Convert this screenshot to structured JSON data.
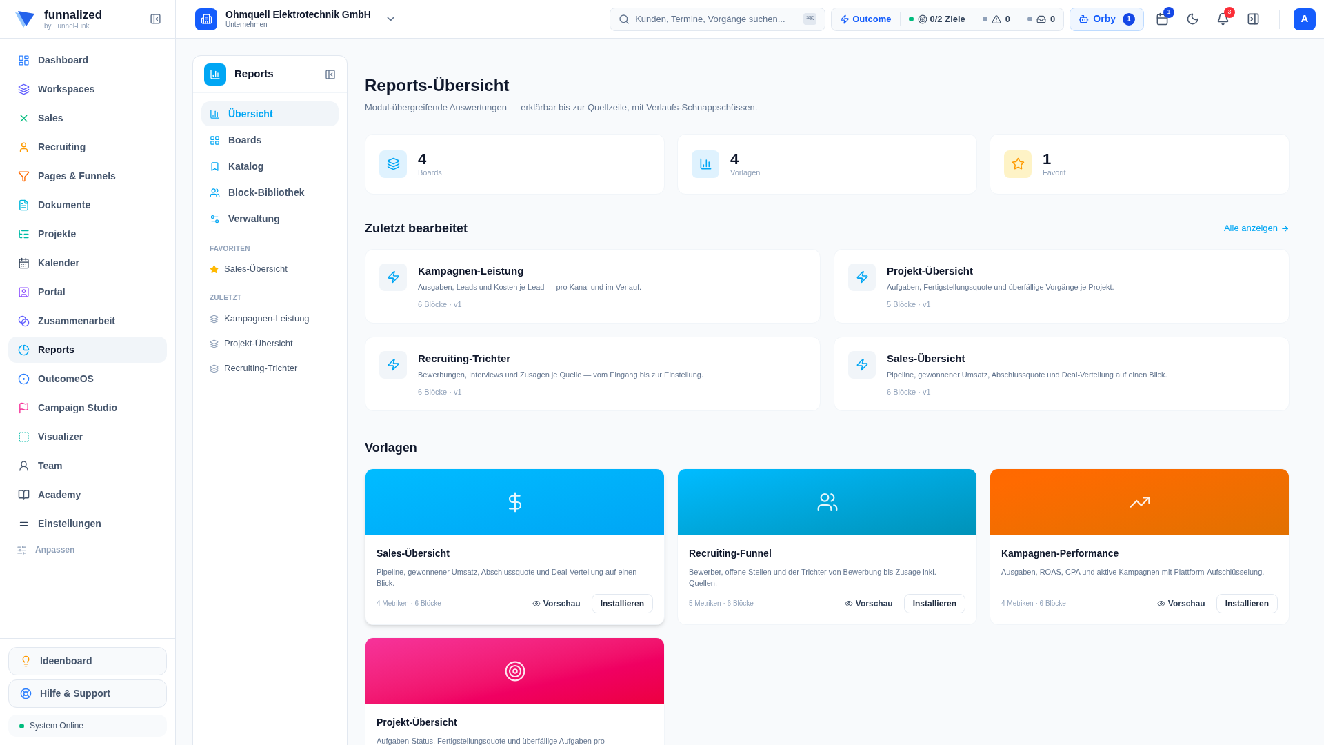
{
  "brand": {
    "name": "funnalized",
    "tagline": "by Funnel-Link"
  },
  "company": {
    "name": "Ohmquell Elektrotechnik GmbH",
    "type": "Unternehmen"
  },
  "search": {
    "placeholder": "Kunden, Termine, Vorgänge suchen...",
    "shortcut": "⌘K"
  },
  "status": {
    "outcome": "Outcome",
    "goals": "0/2 Ziele",
    "warnings": "0",
    "inbox": "0"
  },
  "orby": {
    "label": "Orby",
    "count": "1"
  },
  "calendar_badge": "1",
  "notifications_badge": "3",
  "avatar": "A",
  "nav": {
    "items": [
      {
        "label": "Dashboard",
        "selected": false
      },
      {
        "label": "Workspaces",
        "selected": false
      },
      {
        "label": "Sales",
        "selected": false
      },
      {
        "label": "Recruiting",
        "selected": false
      },
      {
        "label": "Pages & Funnels",
        "selected": false
      },
      {
        "label": "Dokumente",
        "selected": false
      },
      {
        "label": "Projekte",
        "selected": false
      },
      {
        "label": "Kalender",
        "selected": false
      },
      {
        "label": "Portal",
        "selected": false
      },
      {
        "label": "Zusammenarbeit",
        "selected": false
      },
      {
        "label": "Reports",
        "selected": true
      },
      {
        "label": "OutcomeOS",
        "selected": false
      },
      {
        "label": "Campaign Studio",
        "selected": false
      },
      {
        "label": "Visualizer",
        "selected": false
      },
      {
        "label": "Team",
        "selected": false
      },
      {
        "label": "Academy",
        "selected": false
      },
      {
        "label": "Einstellungen",
        "selected": false
      }
    ],
    "customize": "Anpassen"
  },
  "footer": {
    "buttons": [
      "Ideenboard",
      "Hilfe & Support"
    ],
    "status": "System Online"
  },
  "reports_nav": {
    "title": "Reports",
    "items": [
      {
        "label": "Übersicht",
        "selected": true
      },
      {
        "label": "Boards",
        "selected": false
      },
      {
        "label": "Katalog",
        "selected": false
      },
      {
        "label": "Block-Bibliothek",
        "selected": false
      },
      {
        "label": "Verwaltung",
        "selected": false
      }
    ],
    "favorites": {
      "heading": "FAVORITEN",
      "items": [
        "Sales-Übersicht"
      ]
    },
    "recent": {
      "heading": "ZULETZT",
      "items": [
        "Kampagnen-Leistung",
        "Projekt-Übersicht",
        "Recruiting-Trichter"
      ]
    }
  },
  "header": {
    "title": "Reports-Übersicht",
    "subtitle": "Modul-übergreifende Auswertungen — erklärbar bis zur Quellzeile, mit Verlaufs-Schnappschüssen."
  },
  "stats": [
    {
      "value": "4",
      "label": "Boards"
    },
    {
      "value": "4",
      "label": "Vorlagen"
    },
    {
      "value": "1",
      "label": "Favorit"
    }
  ],
  "recent": {
    "title": "Zuletzt bearbeitet",
    "link": "Alle anzeigen",
    "items": [
      {
        "title": "Kampagnen-Leistung",
        "description": "Ausgaben, Leads und Kosten je Lead — pro Kanal und im Verlauf.",
        "meta": "6 Blöcke · v1"
      },
      {
        "title": "Projekt-Übersicht",
        "description": "Aufgaben, Fertigstellungsquote und überfällige Vorgänge je Projekt.",
        "meta": "5 Blöcke · v1"
      },
      {
        "title": "Recruiting-Trichter",
        "description": "Bewerbungen, Interviews und Zusagen je Quelle — vom Eingang bis zur Einstellung.",
        "meta": "6 Blöcke · v1"
      },
      {
        "title": "Sales-Übersicht",
        "description": "Pipeline, gewonnener Umsatz, Abschlussquote und Deal-Verteilung auf einen Blick.",
        "meta": "6 Blöcke · v1"
      }
    ]
  },
  "templates": {
    "title": "Vorlagen",
    "items": [
      {
        "title": "Sales-Übersicht",
        "description": "Pipeline, gewonnener Umsatz, Abschlussquote und Deal-Verteilung auf einen Blick.",
        "meta": "4 Metriken · 6 Blöcke",
        "preview": "Vorschau",
        "install": "Installieren"
      },
      {
        "title": "Recruiting-Funnel",
        "description": "Bewerber, offene Stellen und der Trichter von Bewerbung bis Zusage inkl. Quellen.",
        "meta": "5 Metriken · 6 Blöcke",
        "preview": "Vorschau",
        "install": "Installieren"
      },
      {
        "title": "Kampagnen-Performance",
        "description": "Ausgaben, ROAS, CPA und aktive Kampagnen mit Plattform-Aufschlüsselung.",
        "meta": "4 Metriken · 6 Blöcke",
        "preview": "Vorschau",
        "install": "Installieren"
      },
      {
        "title": "Projekt-Übersicht",
        "description": "Aufgaben-Status, Fertigstellungsquote und überfällige Aufgaben pro"
      }
    ]
  }
}
